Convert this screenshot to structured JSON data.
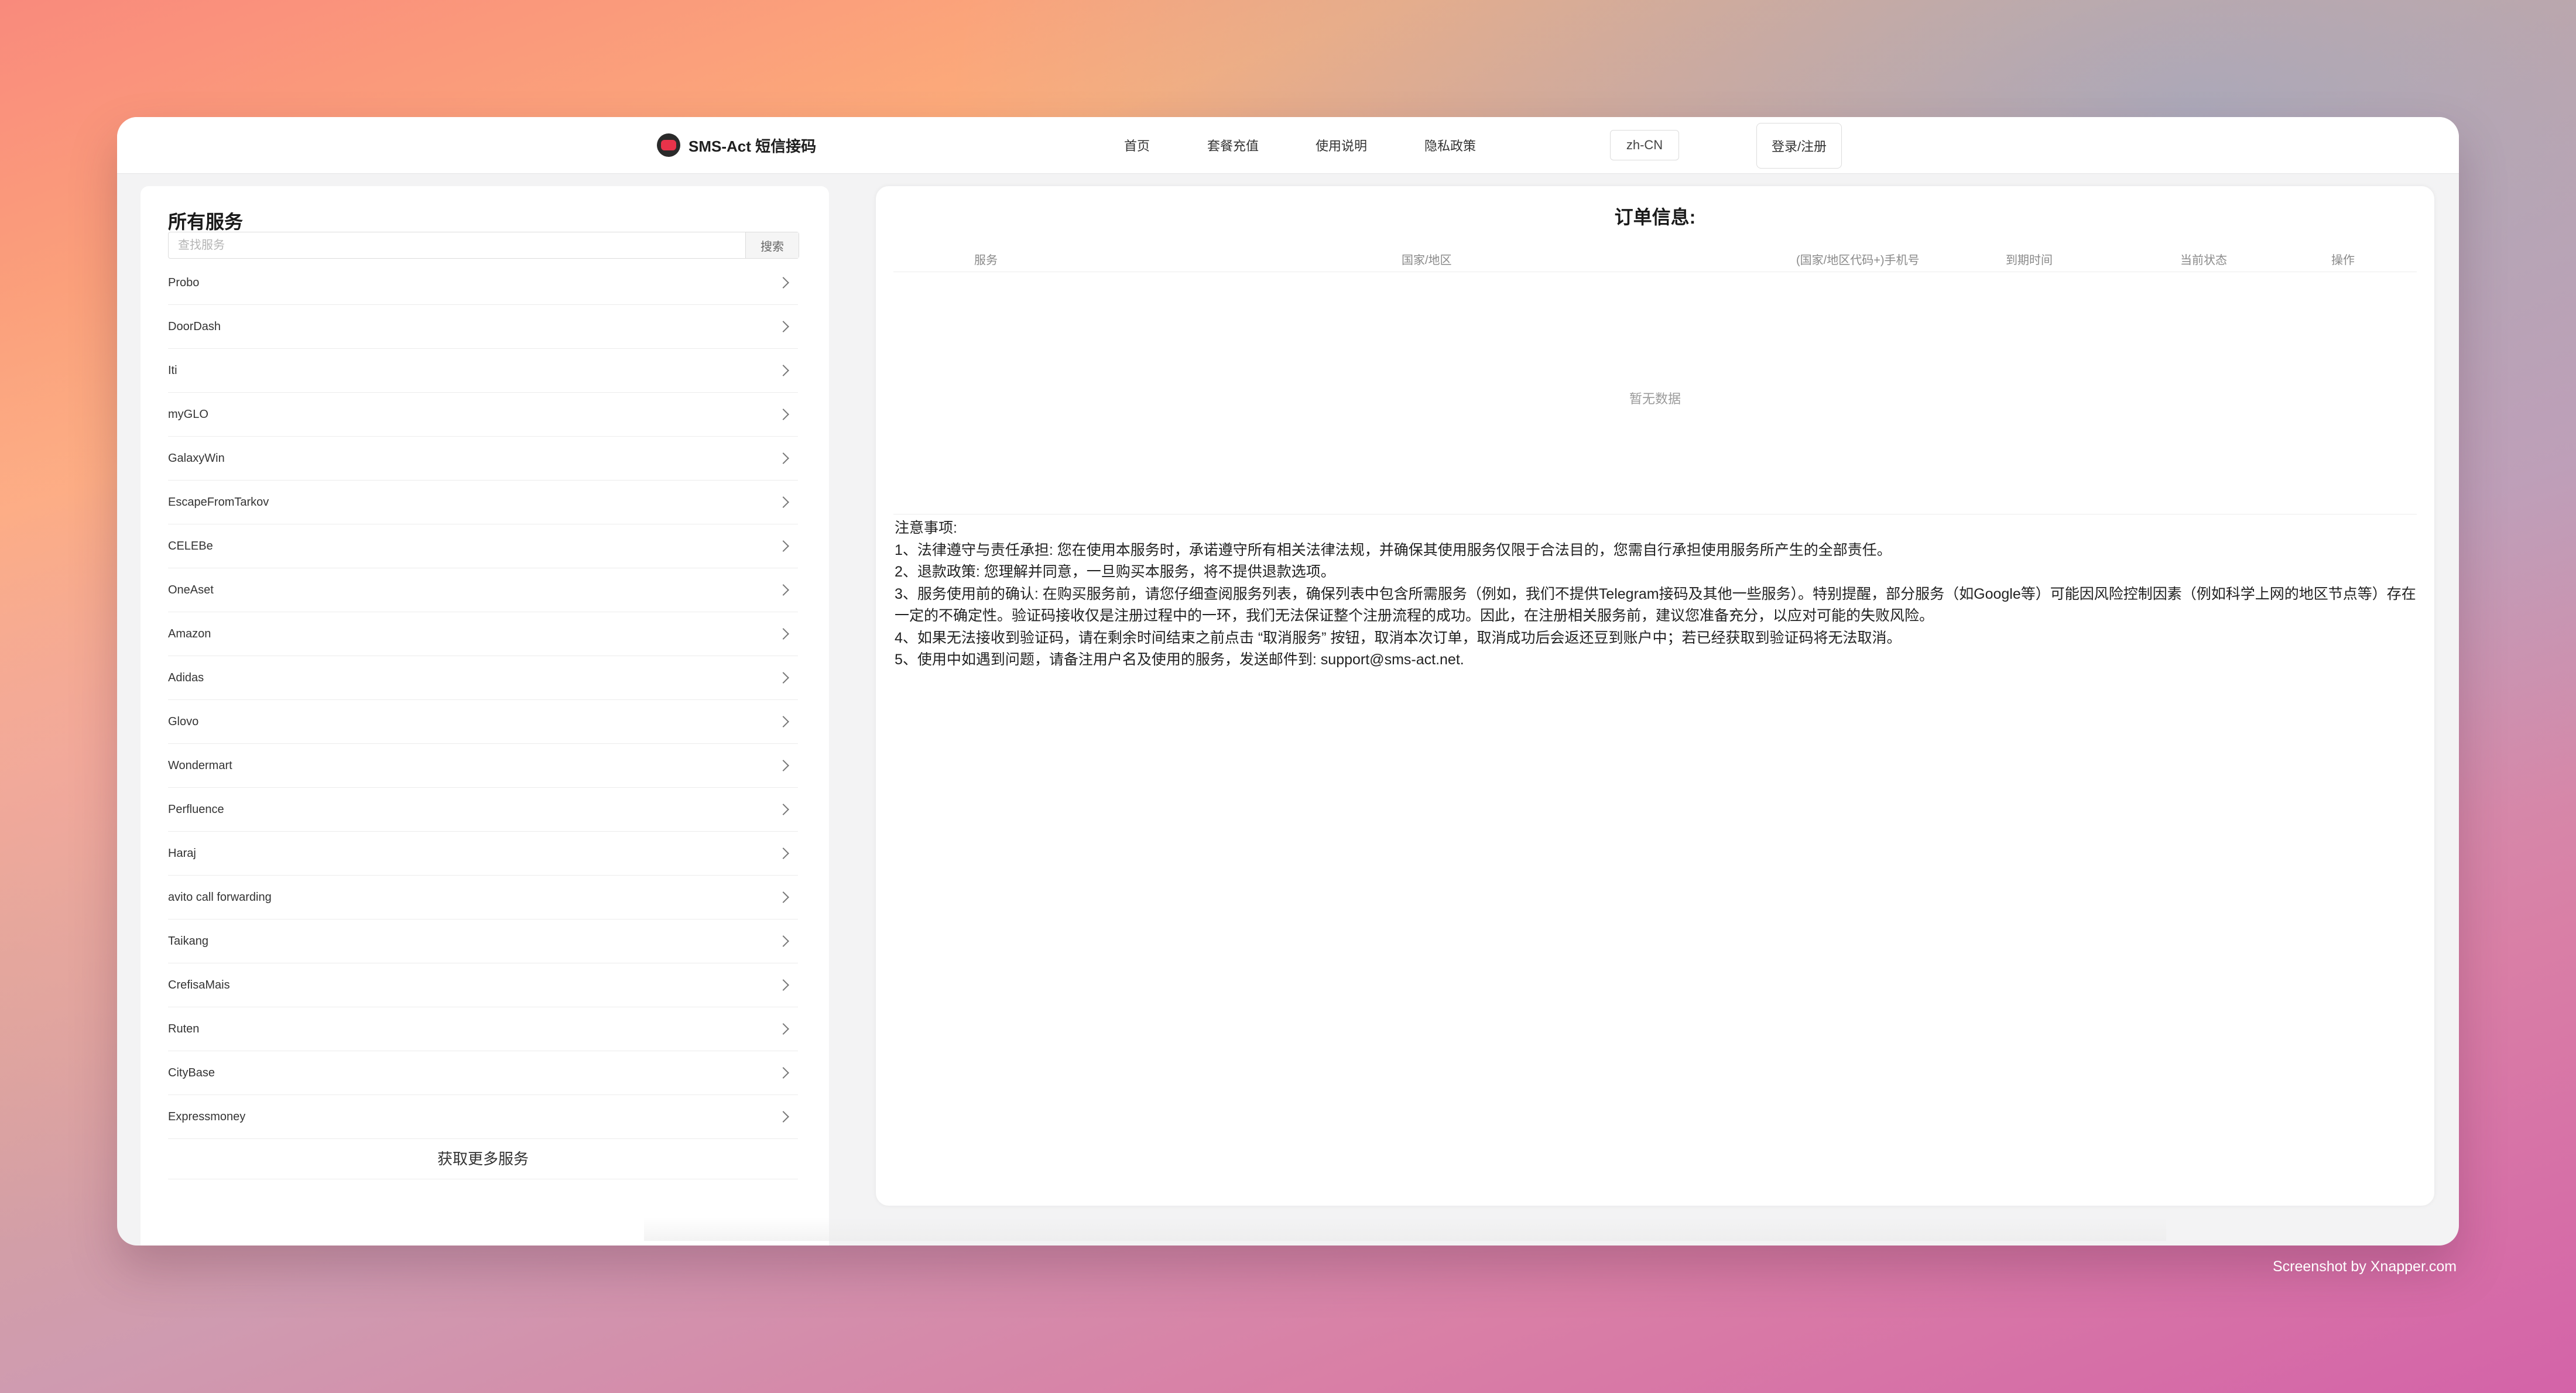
{
  "navbar": {
    "brand": "SMS-Act 短信接码",
    "links": [
      "首页",
      "套餐充值",
      "使用说明",
      "隐私政策"
    ],
    "language": "zh-CN",
    "login": "登录/注册"
  },
  "sidebar": {
    "title": "所有服务",
    "search_placeholder": "查找服务",
    "search_button": "搜索",
    "services": [
      "Probo",
      "DoorDash",
      "Iti",
      "myGLO",
      "GalaxyWin",
      "EscapeFromTarkov",
      "CELEBe",
      "OneAset",
      "Amazon",
      "Adidas",
      "Glovo",
      "Wondermart",
      "Perfluence",
      "Haraj",
      "avito call forwarding",
      "Taikang",
      "CrefisaMais",
      "Ruten",
      "CityBase",
      "Expressmoney"
    ],
    "more": "获取更多服务"
  },
  "orders": {
    "title": "订单信息:",
    "columns": [
      "服务",
      "国家/地区",
      "(国家/地区代码+)手机号",
      "到期时间",
      "当前状态",
      "操作"
    ],
    "empty": "暂无数据"
  },
  "notice": {
    "heading": "注意事项:",
    "items": [
      "1、法律遵守与责任承担: 您在使用本服务时，承诺遵守所有相关法律法规，并确保其使用服务仅限于合法目的，您需自行承担使用服务所产生的全部责任。",
      "2、退款政策: 您理解并同意，一旦购买本服务，将不提供退款选项。",
      "3、服务使用前的确认: 在购买服务前，请您仔细查阅服务列表，确保列表中包含所需服务（例如，我们不提供Telegram接码及其他一些服务）。特别提醒，部分服务（如Google等）可能因风险控制因素（例如科学上网的地区节点等）存在一定的不确定性。验证码接收仅是注册过程中的一环，我们无法保证整个注册流程的成功。因此，在注册相关服务前，建议您准备充分，以应对可能的失败风险。",
      "4、如果无法接收到验证码，请在剩余时间结束之前点击 “取消服务” 按钮，取消本次订单，取消成功后会返还豆到账户中；若已经获取到验证码将无法取消。",
      "5、使用中如遇到问题，请备注用户名及使用的服务，发送邮件到: support@sms-act.net."
    ]
  },
  "watermark": "Screenshot by Xnapper.com"
}
